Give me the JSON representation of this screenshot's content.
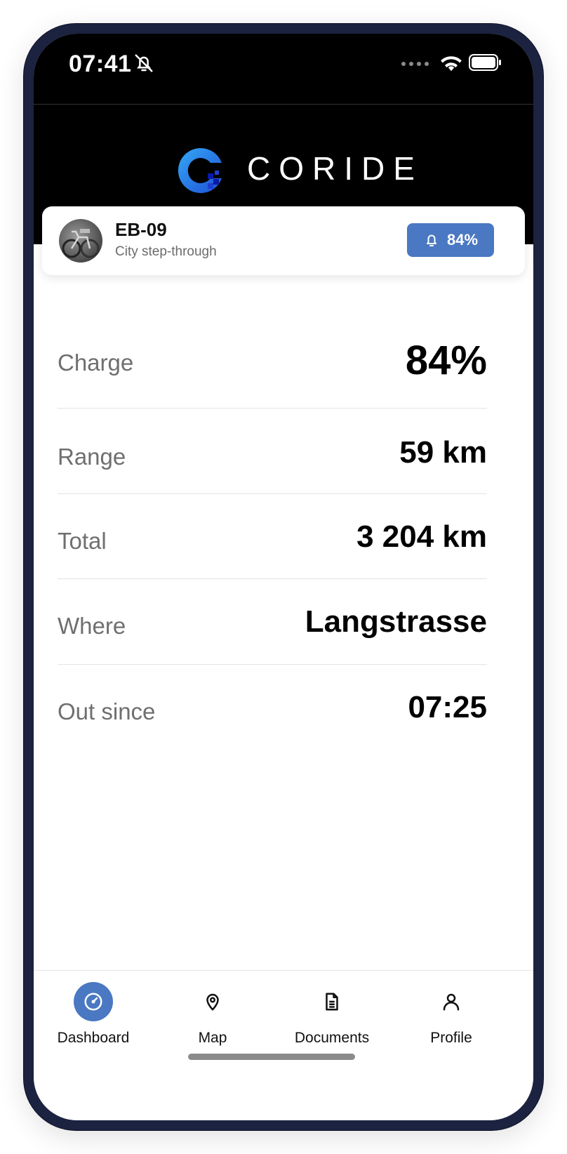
{
  "status": {
    "time": "07:41"
  },
  "header": {
    "brand": "CORIDE"
  },
  "vehicle": {
    "id": "EB-09",
    "type": "City step-through",
    "alert_battery": "84%"
  },
  "stats": [
    {
      "label": "Charge",
      "value": "84%"
    },
    {
      "label": "Range",
      "value": "59 km"
    },
    {
      "label": "Total",
      "value": "3 204 km"
    },
    {
      "label": "Where",
      "value": "Langstrasse"
    },
    {
      "label": "Out since",
      "value": "07:25"
    }
  ],
  "nav": [
    {
      "label": "Dashboard",
      "icon": "gauge-icon",
      "active": true
    },
    {
      "label": "Map",
      "icon": "map-pin-icon",
      "active": false
    },
    {
      "label": "Documents",
      "icon": "document-icon",
      "active": false
    },
    {
      "label": "Profile",
      "icon": "user-icon",
      "active": false
    }
  ],
  "colors": {
    "accent": "#4a78c2",
    "header_bg": "#000000",
    "frame": "#1c2340"
  }
}
